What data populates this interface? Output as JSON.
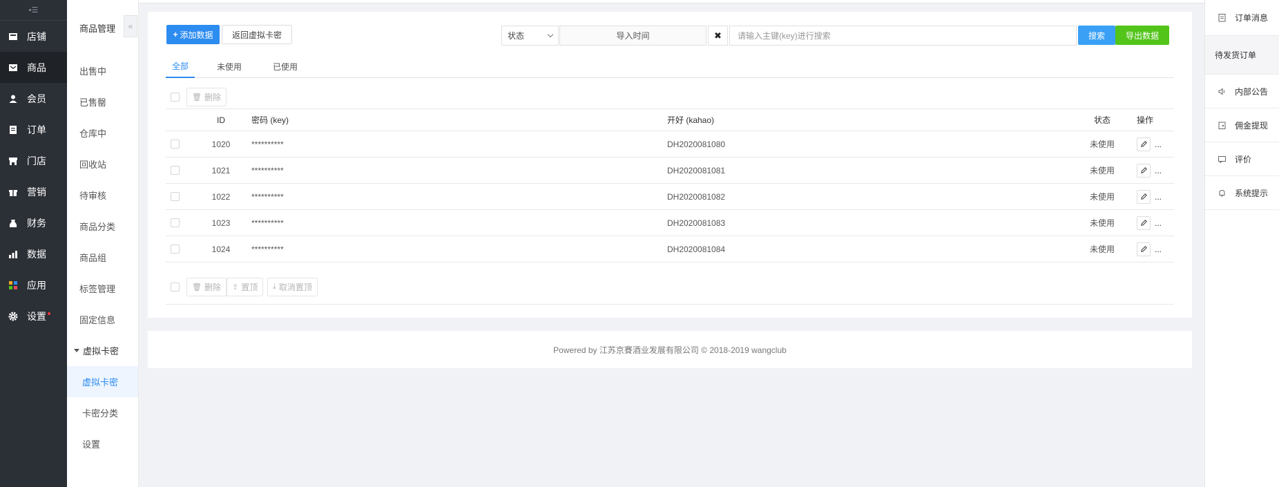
{
  "nav": {
    "toggle": "•☰",
    "items": [
      {
        "label": "店铺",
        "icon": "store-icon"
      },
      {
        "label": "商品",
        "icon": "goods-icon"
      },
      {
        "label": "会员",
        "icon": "member-icon"
      },
      {
        "label": "订单",
        "icon": "order-icon"
      },
      {
        "label": "门店",
        "icon": "shop-icon"
      },
      {
        "label": "营销",
        "icon": "gift-icon"
      },
      {
        "label": "财务",
        "icon": "finance-icon"
      },
      {
        "label": "数据",
        "icon": "data-icon"
      },
      {
        "label": "应用",
        "icon": "apps-icon"
      },
      {
        "label": "设置",
        "icon": "gear-icon"
      }
    ]
  },
  "subnav": {
    "title": "商品管理",
    "collapse": "«",
    "items": [
      "出售中",
      "已售罄",
      "仓库中",
      "回收站",
      "待审核",
      "商品分类",
      "商品组",
      "标签管理",
      "固定信息"
    ],
    "group": "虚拟卡密",
    "children": [
      "虚拟卡密",
      "卡密分类",
      "设置"
    ]
  },
  "toolbar": {
    "add": "添加数据",
    "back": "返回虚拟卡密",
    "status_select": "状态",
    "import_time": "导入时间",
    "clear": "✖",
    "search_placeholder": "请输入主键(key)进行搜索",
    "search": "搜索",
    "export": "导出数据"
  },
  "tabs": [
    "全部",
    "未使用",
    "已使用"
  ],
  "actions": {
    "delete": "删除",
    "top": "置顶",
    "untop": "取消置顶"
  },
  "table": {
    "headers": {
      "id": "ID",
      "key": "密码 (key)",
      "kahao": "开好 (kahao)",
      "status": "状态",
      "op": "操作"
    },
    "rows": [
      {
        "id": "1020",
        "key": "**********",
        "kahao": "DH2020081080",
        "status": "未使用"
      },
      {
        "id": "1021",
        "key": "**********",
        "kahao": "DH2020081081",
        "status": "未使用"
      },
      {
        "id": "1022",
        "key": "**********",
        "kahao": "DH2020081082",
        "status": "未使用"
      },
      {
        "id": "1023",
        "key": "**********",
        "kahao": "DH2020081083",
        "status": "未使用"
      },
      {
        "id": "1024",
        "key": "**********",
        "kahao": "DH2020081084",
        "status": "未使用"
      }
    ],
    "more": "..."
  },
  "footer": "Powered by 江苏京賽酒业发展有限公司 © 2018-2019 wangclub",
  "right_panel": {
    "order_msg": "订单消息",
    "pending_orders": "待发货订单",
    "items": [
      {
        "label": "内部公告",
        "icon": "speaker-icon"
      },
      {
        "label": "佣金提现",
        "icon": "wallet-icon"
      },
      {
        "label": "评价",
        "icon": "comment-icon"
      },
      {
        "label": "系统提示",
        "icon": "bell-icon"
      }
    ]
  },
  "colors": {
    "primary": "#2d8cf0",
    "success": "#52c41a",
    "status_green": "#1e9e3a",
    "nav_bg": "#2b2f36"
  }
}
